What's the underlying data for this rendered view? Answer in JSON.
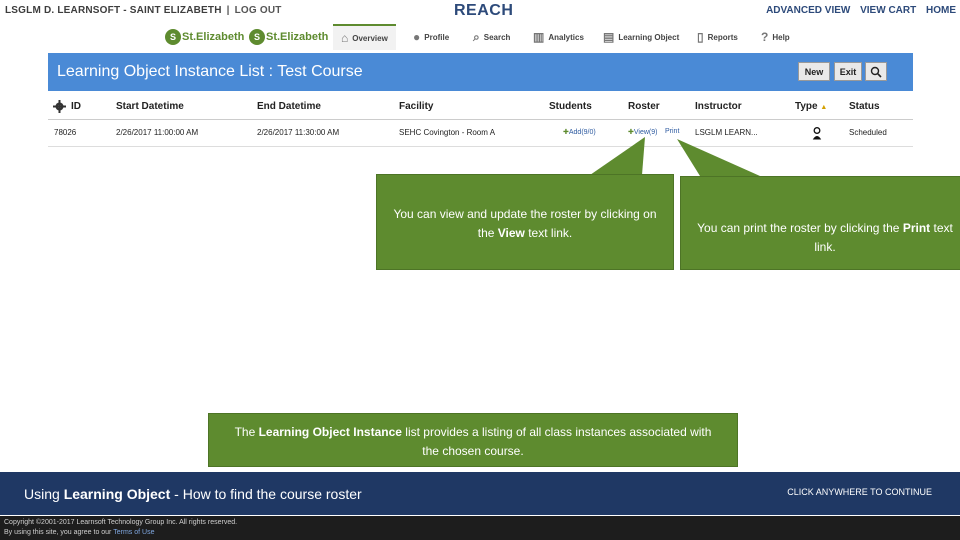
{
  "topbar": {
    "user": "LSGLM D. LEARNSOFT - SAINT ELIZABETH",
    "separator": "|",
    "logout": "LOG OUT",
    "brand": "REACH",
    "links": [
      "ADVANCED VIEW",
      "VIEW CART",
      "HOME"
    ]
  },
  "nav": {
    "logo1": "St.Elizabeth",
    "logo2": "St.Elizabeth",
    "items": [
      "Overview",
      "Profile",
      "Search",
      "Analytics",
      "Learning Object",
      "Reports",
      "Help"
    ]
  },
  "panel": {
    "title": "Learning Object Instance List : Test Course",
    "buttons": [
      "New",
      "Exit"
    ],
    "search_icon": "search-icon"
  },
  "table": {
    "headers": [
      "ID",
      "Start Datetime",
      "End Datetime",
      "Facility",
      "Students",
      "Roster",
      "Instructor",
      "Type",
      "Status"
    ],
    "rows": [
      {
        "id": "78026",
        "start": "2/26/2017 11:00:00 AM",
        "end": "2/26/2017 11:30:00 AM",
        "facility": "SEHC Covington - Room A",
        "students": "Add(9/0)",
        "roster_view": "View(9)",
        "roster_print": "Print",
        "instructor": "LSGLM LEARN...",
        "type_icon": "person-icon",
        "status": "Scheduled"
      }
    ]
  },
  "callouts": {
    "view": {
      "prefix": "You can view and update the roster by clicking on the ",
      "bold": "View",
      "suffix": " text link."
    },
    "print": {
      "prefix": "You can print the roster by clicking the ",
      "bold": "Print",
      "suffix": " text link."
    },
    "list": {
      "prefix": "The ",
      "bold": "Learning Object Instance",
      "suffix": " list provides a listing of all class instances associated with the chosen course."
    }
  },
  "footer": {
    "title_prefix": "Using ",
    "title_bold": "Learning Object",
    "title_suffix": " - How to find the course roster",
    "continue": "CLICK ANYWHERE TO CONTINUE",
    "copyright1": "Copyright ©2001-2017 Learnsoft Technology Group Inc. All rights reserved.",
    "copyright2": "By using this site, you agree to our",
    "terms": "Terms of Use"
  },
  "colors": {
    "accent": "#4a8ad6",
    "callout": "#5e8b2f",
    "footer": "#1f3864",
    "brand": "#2d4a7a"
  }
}
